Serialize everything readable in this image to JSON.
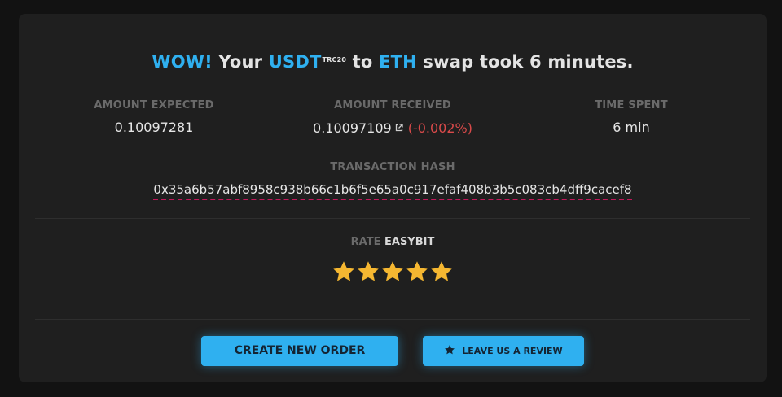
{
  "headline": {
    "exclaim": "WOW!",
    "your": "Your",
    "from_coin": "USDT",
    "from_network": "TRC20",
    "to": "to",
    "to_coin": "ETH",
    "suffix": "swap took 6 minutes."
  },
  "stats": {
    "expected": {
      "label": "AMOUNT EXPECTED",
      "value": "0.10097281"
    },
    "received": {
      "label": "AMOUNT RECEIVED",
      "value": "0.10097109",
      "diff": "(-0.002%)"
    },
    "time": {
      "label": "TIME SPENT",
      "value": "6 min"
    }
  },
  "transaction": {
    "label": "TRANSACTION HASH",
    "hash": "0x35a6b57abf8958c938b66c1b6f5e65a0c917efaf408b3b5c083cb4dff9cacef8"
  },
  "rating": {
    "label": "RATE",
    "brand": "EASYBIT",
    "stars": 5,
    "star_color": "#f5b731"
  },
  "buttons": {
    "create": "CREATE NEW ORDER",
    "review": "LEAVE US A REVIEW"
  },
  "colors": {
    "accent": "#2fb0f0",
    "negative": "#d94a4a",
    "hash_underline": "#c2185b"
  },
  "icons": {
    "external_link": "external-link-icon",
    "star": "star-icon"
  }
}
